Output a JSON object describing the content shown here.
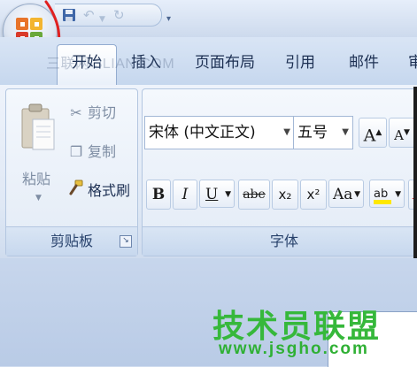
{
  "tabs": [
    {
      "label": "开始",
      "active": true
    },
    {
      "label": "插入",
      "active": false
    },
    {
      "label": "页面布局",
      "active": false
    },
    {
      "label": "引用",
      "active": false
    },
    {
      "label": "邮件",
      "active": false
    },
    {
      "label": "审",
      "active": false
    }
  ],
  "watermark_top": "三联网 3LIAN.COM",
  "clipboard": {
    "paste": "粘贴",
    "cut": "剪切",
    "copy": "复制",
    "format_painter": "格式刷",
    "group_label": "剪贴板"
  },
  "font": {
    "font_name": "宋体 (中文正文)",
    "font_size": "五号",
    "grow": "A",
    "shrink": "A",
    "bold": "B",
    "italic": "I",
    "underline": "U",
    "strike": "abe",
    "subscript": "x₂",
    "superscript": "x²",
    "change_case": "Aa",
    "highlight": "ab",
    "font_color": "A",
    "group_label": "字体"
  },
  "watermark": {
    "cn": "技术员联盟",
    "url": "www.jsgho.com"
  },
  "colors": {
    "annotation": "#e02020",
    "highlight": "#ffe800",
    "font_color": "#e02020",
    "watermark": "#36b83b"
  },
  "icons": {
    "office_button": "office-logo-icon",
    "save": "save-icon",
    "undo": "undo-icon",
    "redo": "redo-icon",
    "qat_customize": "chevron-down-icon"
  }
}
